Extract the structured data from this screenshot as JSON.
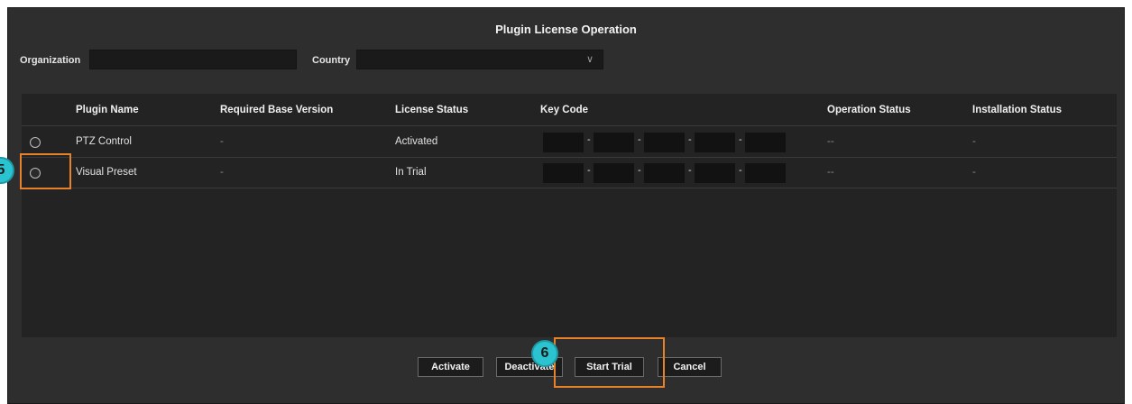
{
  "dialog": {
    "title": "Plugin License Operation"
  },
  "form": {
    "organization_label": "Organization",
    "organization_value": "",
    "country_label": "Country",
    "country_value": "",
    "chevron": "∨"
  },
  "table": {
    "columns": [
      "Plugin Name",
      "Required Base Version",
      "License Status",
      "Key Code",
      "Operation Status",
      "Installation Status"
    ],
    "rows": [
      {
        "selected": false,
        "plugin_name": "PTZ Control",
        "required_base_version": "-",
        "license_status": "Activated",
        "key_code": [
          "",
          "",
          "",
          "",
          ""
        ],
        "operation_status": "--",
        "installation_status": "-"
      },
      {
        "selected": false,
        "plugin_name": "Visual Preset",
        "required_base_version": "-",
        "license_status": "In Trial",
        "key_code": [
          "",
          "",
          "",
          "",
          ""
        ],
        "operation_status": "--",
        "installation_status": "-"
      }
    ],
    "key_separator": "-"
  },
  "buttons": {
    "activate": "Activate",
    "deactivate": "Deactivate",
    "start_trial": "Start Trial",
    "cancel": "Cancel"
  },
  "annotations": {
    "badge_5": "5",
    "badge_6": "6",
    "highlight_color": "#e8822a",
    "badge_color": "#2bc3d0"
  }
}
